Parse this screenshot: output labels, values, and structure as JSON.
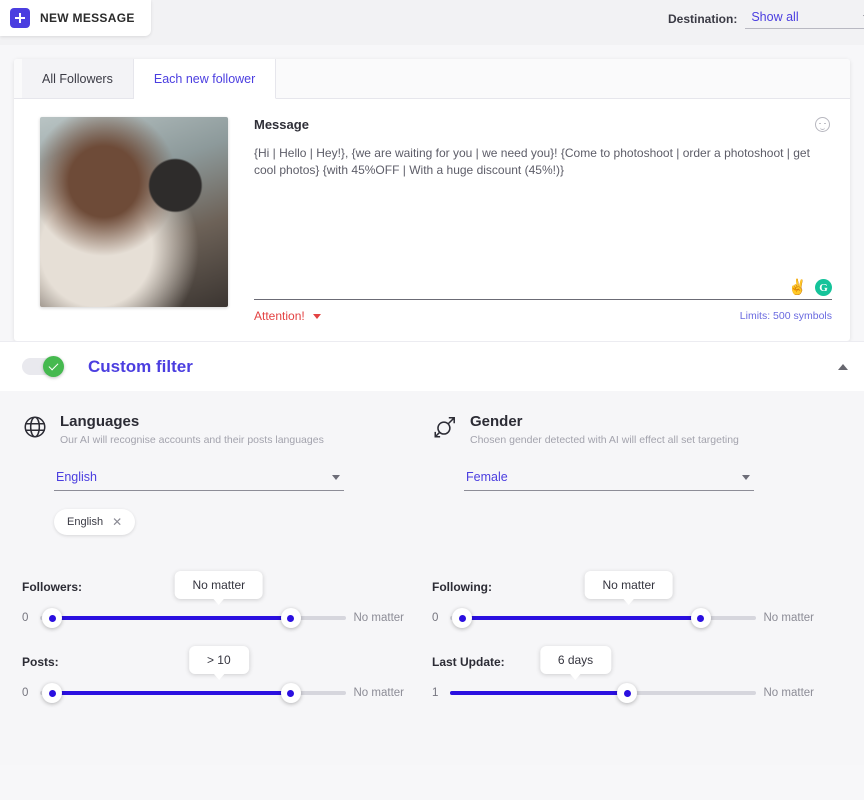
{
  "topbar": {
    "new_message_label": "NEW MESSAGE",
    "destination_label": "Destination:",
    "destination_value": "Show all"
  },
  "card": {
    "tabs": [
      {
        "label": "All Followers",
        "active": false
      },
      {
        "label": "Each new follower",
        "active": true
      }
    ],
    "message_label": "Message",
    "message_text": "{Hi | Hello | Hey!}, {we are waiting for you | we need you}! {Come to photoshoot | order a photoshoot | get cool photos} {with 45%OFF | With a huge discount (45%!)}",
    "attention_label": "Attention!",
    "limits_label": "Limits: 500 symbols",
    "hand_emoji": "✌️",
    "grammar_badge": "G"
  },
  "filter": {
    "title": "Custom filter",
    "toggle_on": true,
    "languages": {
      "title": "Languages",
      "subtitle": "Our AI will recognise accounts and their posts languages",
      "selected": "English",
      "chips": [
        "English"
      ]
    },
    "gender": {
      "title": "Gender",
      "subtitle": "Chosen gender detected with AI will effect all set targeting",
      "selected": "Female"
    },
    "sliders": [
      {
        "label": "Followers:",
        "min": "0",
        "max": "No matter",
        "bubble": "No matter",
        "left_pct": 4,
        "right_pct": 82,
        "dual": true
      },
      {
        "label": "Following:",
        "min": "0",
        "max": "No matter",
        "bubble": "No matter",
        "left_pct": 4,
        "right_pct": 82,
        "dual": true
      },
      {
        "label": "Posts:",
        "min": "0",
        "max": "No matter",
        "bubble": "> 10",
        "left_pct": 4,
        "right_pct": 82,
        "dual": true
      },
      {
        "label": "Last Update:",
        "min": "1",
        "max": "No matter",
        "bubble": "6 days",
        "left_pct": 0,
        "right_pct": 58,
        "dual": false
      }
    ]
  },
  "colors": {
    "accent": "#4b3ee0",
    "slider": "#2a0fe0",
    "danger": "#e34242",
    "success": "#45b94f",
    "grammar": "#15c39a"
  }
}
